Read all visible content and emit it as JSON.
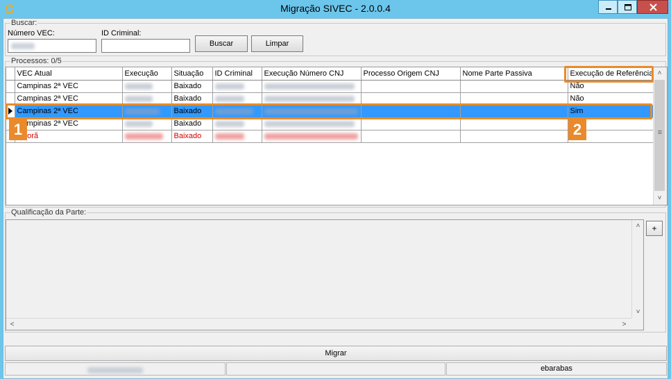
{
  "window": {
    "title": "Migração SIVEC - 2.0.0.4"
  },
  "search": {
    "group_label": "Buscar:",
    "numero_vec_label": "Número VEC:",
    "numero_vec_value": "",
    "id_criminal_label": "ID Criminal:",
    "id_criminal_value": "",
    "buscar_label": "Buscar",
    "limpar_label": "Limpar"
  },
  "processos": {
    "group_label": "Processos: 0/5",
    "columns": [
      "VEC Atual",
      "Execução",
      "Situação",
      "ID Criminal",
      "Execução Número CNJ",
      "Processo Origem CNJ",
      "Nome Parte Passiva",
      "Execução de Referência"
    ],
    "rows": [
      {
        "vec_atual": "Campinas 2ª VEC",
        "situacao": "Baixado",
        "referencia": "Não",
        "selected": false,
        "red": false
      },
      {
        "vec_atual": "Campinas 2ª VEC",
        "situacao": "Baixado",
        "referencia": "Não",
        "selected": false,
        "red": false
      },
      {
        "vec_atual": "Campinas 2ª VEC",
        "situacao": "Baixado",
        "referencia": "Sim",
        "selected": true,
        "red": false
      },
      {
        "vec_atual": "Campinas 2ª VEC",
        "situacao": "Baixado",
        "referencia": "",
        "selected": false,
        "red": false
      },
      {
        "vec_atual": "Itiporã",
        "situacao": "Baixado",
        "referencia": "",
        "selected": false,
        "red": true
      }
    ]
  },
  "annotations": {
    "badge_1": "1",
    "badge_2": "2",
    "color": "#e98a2c"
  },
  "qualificacao": {
    "group_label": "Qualificação da Parte:",
    "plus_label": "+"
  },
  "actions": {
    "migrar_label": "Migrar"
  },
  "status_bar": {
    "user": "ebarabas"
  },
  "colors": {
    "title_bar": "#6cc6ec",
    "selection": "#3399ff",
    "error_text": "#d40000",
    "close_button": "#c7504c"
  }
}
